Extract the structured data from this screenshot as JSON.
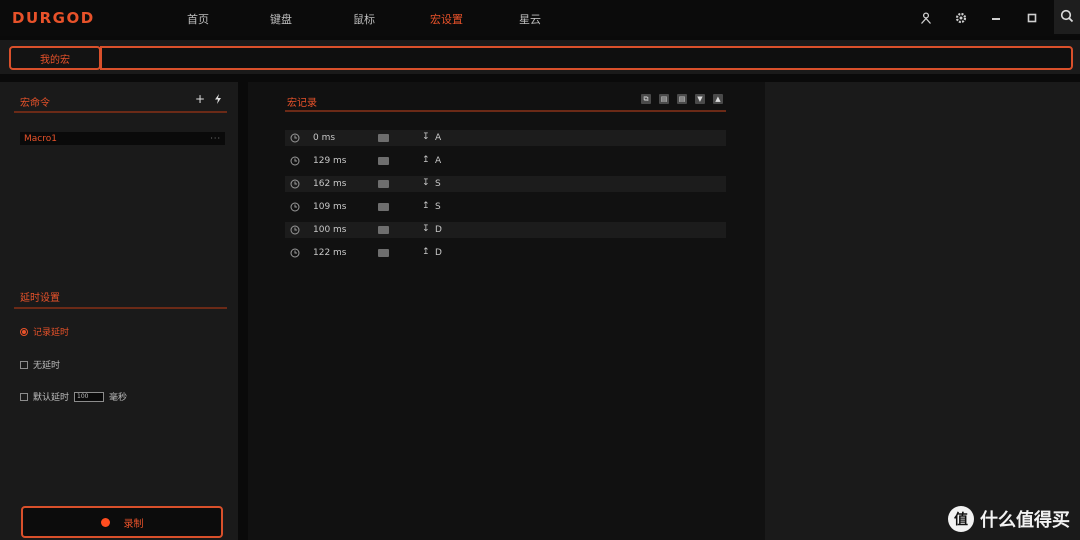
{
  "app": {
    "logo": "DURGOD"
  },
  "nav": {
    "items": [
      {
        "label": "首页"
      },
      {
        "label": "键盘"
      },
      {
        "label": "鼠标"
      },
      {
        "label": "宏设置",
        "active": true
      },
      {
        "label": "星云"
      }
    ]
  },
  "window_controls": [
    "user-icon",
    "gear-icon",
    "minimize-icon",
    "maximize-icon",
    "search-icon"
  ],
  "tabs": {
    "my_macro": "我的宏",
    "name_value": ""
  },
  "macro_commands": {
    "title": "宏命令",
    "add_icon": "plus-icon",
    "import_icon": "lightning-icon",
    "items": [
      {
        "name": "Macro1",
        "more": "···"
      }
    ]
  },
  "delay_settings": {
    "title": "延时设置",
    "options": [
      {
        "label": "记录延时",
        "selected": true
      },
      {
        "label": "无延时",
        "selected": false
      },
      {
        "label": "默认延时",
        "selected": false,
        "value": "100",
        "unit": "毫秒"
      }
    ]
  },
  "record_button": {
    "label": "录制"
  },
  "macro_records": {
    "title": "宏记录",
    "toolbar_icons": [
      "copy-icon",
      "delete-icon",
      "delete-all-icon",
      "move-down-icon",
      "move-up-icon"
    ],
    "rows": [
      {
        "time": "0 ms",
        "direction": "down",
        "key": "A"
      },
      {
        "time": "129 ms",
        "direction": "up",
        "key": "A"
      },
      {
        "time": "162 ms",
        "direction": "down",
        "key": "S"
      },
      {
        "time": "109 ms",
        "direction": "up",
        "key": "S"
      },
      {
        "time": "100 ms",
        "direction": "down",
        "key": "D"
      },
      {
        "time": "122 ms",
        "direction": "up",
        "key": "D"
      }
    ]
  },
  "watermark": {
    "badge": "值",
    "text": "什么值得买"
  },
  "colors": {
    "accent": "#e8522a",
    "bg": "#0a0a0a",
    "panel": "#1a1a1a"
  }
}
